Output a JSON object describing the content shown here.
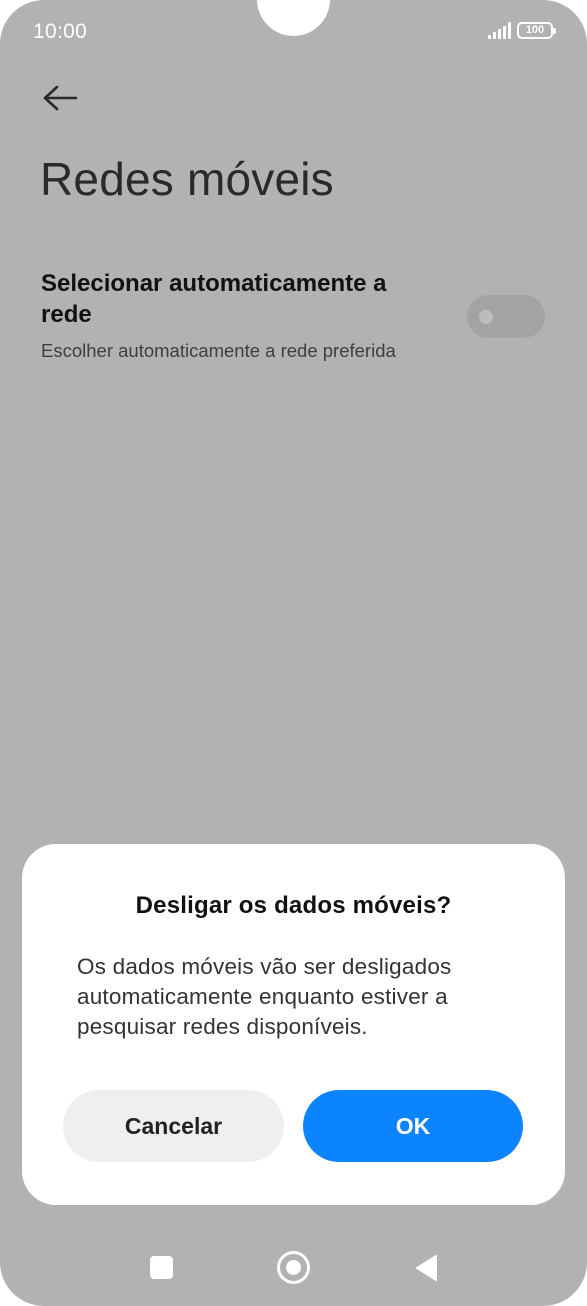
{
  "status_bar": {
    "time": "10:00",
    "battery": "100"
  },
  "page": {
    "title": "Redes móveis"
  },
  "setting": {
    "title": "Selecionar automaticamente a rede",
    "subtitle": "Escolher automaticamente a rede preferida",
    "toggle_on": false
  },
  "dialog": {
    "title": "Desligar os dados móveis?",
    "message": "Os dados móveis vão ser desligados automaticamente enquanto estiver a pesquisar redes disponíveis.",
    "cancel_label": "Cancelar",
    "ok_label": "OK"
  },
  "colors": {
    "scrim": "#b2b2b2",
    "accent": "#0d84ff",
    "cancel_bg": "#efefef"
  },
  "icons": {
    "back": "back-arrow-icon",
    "signal": "signal-icon",
    "battery": "battery-icon",
    "nav_recents": "recents-square-icon",
    "nav_home": "home-circle-icon",
    "nav_back": "back-triangle-icon"
  }
}
